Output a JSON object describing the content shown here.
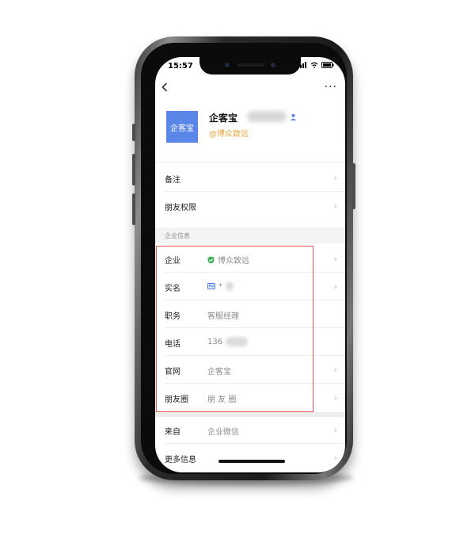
{
  "status": {
    "time": "15:57"
  },
  "nav": {
    "back_icon": "chevron-left-icon",
    "more_label": "···"
  },
  "profile": {
    "avatar_text": "企客宝",
    "name": "企客宝",
    "company": "@博众致远",
    "accent": "#5a86e8",
    "company_color": "#e8a33a"
  },
  "settings_rows": [
    {
      "label": "备注"
    },
    {
      "label": "朋友权限"
    }
  ],
  "section": {
    "title": "企业信息"
  },
  "info_rows": [
    {
      "label": "企业",
      "value": "博众致远"
    },
    {
      "label": "实名",
      "value": "*"
    },
    {
      "label": "职务",
      "value": "客服经理"
    },
    {
      "label": "电话",
      "value": "136"
    },
    {
      "label": "官网",
      "value": "企客宝"
    },
    {
      "label": "朋友圈",
      "value": "朋 友 圈"
    }
  ],
  "extra_rows": [
    {
      "label": "来自",
      "value": "企业微信"
    },
    {
      "label": "更多信息"
    }
  ],
  "highlight_color": "#e8564f",
  "chevron": "›"
}
